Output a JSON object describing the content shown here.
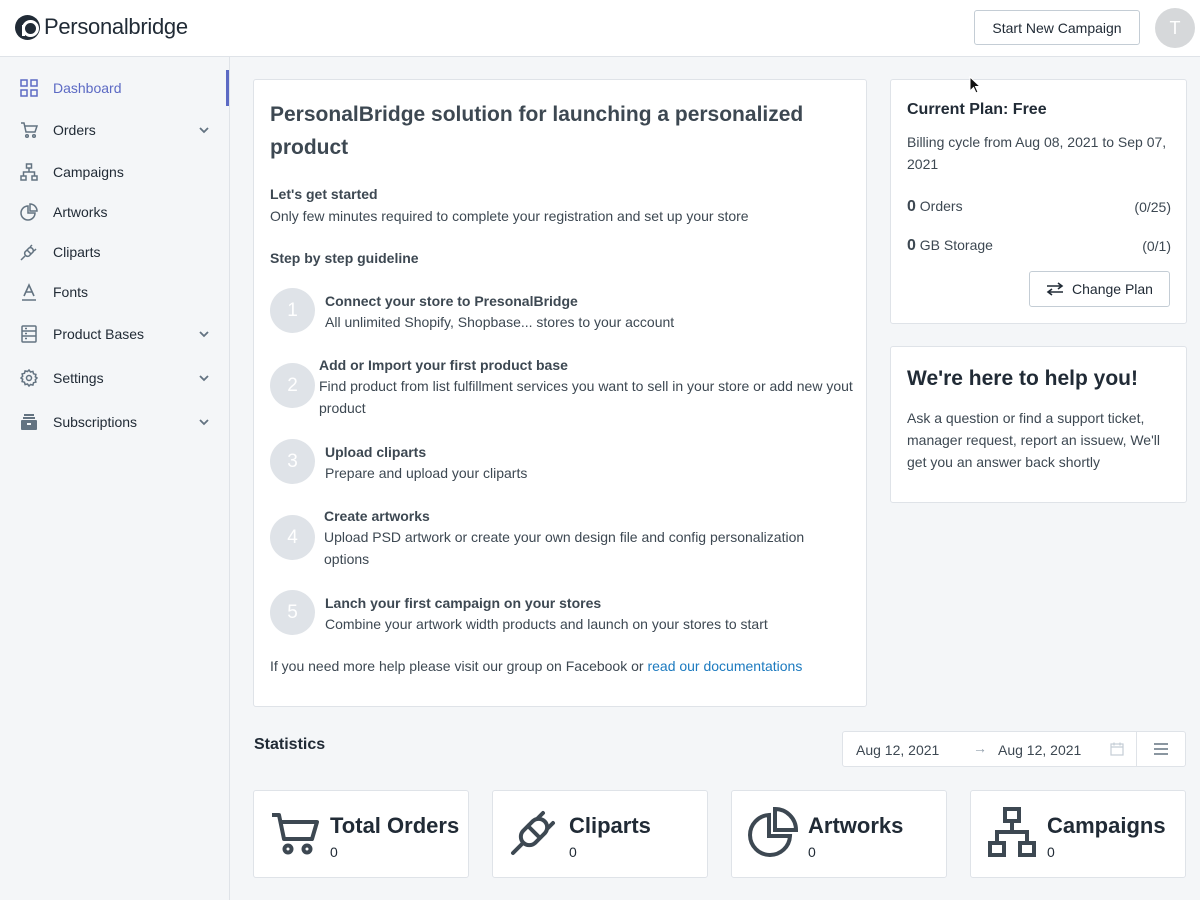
{
  "header": {
    "logo_text": "Personalbridge",
    "new_campaign_label": "Start New Campaign",
    "avatar_initial": "T"
  },
  "sidebar": {
    "items": [
      {
        "label": "Dashboard",
        "icon": "grid-icon",
        "active": true,
        "has_chevron": false
      },
      {
        "label": "Orders",
        "icon": "cart-icon",
        "active": false,
        "has_chevron": true
      },
      {
        "label": "Campaigns",
        "icon": "sitemap-icon",
        "active": false,
        "has_chevron": false
      },
      {
        "label": "Artworks",
        "icon": "pie-chart-icon",
        "active": false,
        "has_chevron": false
      },
      {
        "label": "Cliparts",
        "icon": "plug-icon",
        "active": false,
        "has_chevron": false
      },
      {
        "label": "Fonts",
        "icon": "font-icon",
        "active": false,
        "has_chevron": false
      },
      {
        "label": "Product Bases",
        "icon": "database-icon",
        "active": false,
        "has_chevron": true
      },
      {
        "label": "Settings",
        "icon": "gear-icon",
        "active": false,
        "has_chevron": true
      },
      {
        "label": "Subscriptions",
        "icon": "subscription-icon",
        "active": false,
        "has_chevron": true
      }
    ]
  },
  "guide": {
    "title": "PersonalBridge solution for launching a personalized product",
    "get_started": "Let's get started",
    "get_started_desc": "Only few minutes required to complete your registration and set up your store",
    "guideline_heading": "Step by step guideline",
    "steps": [
      {
        "num": "1",
        "title": "Connect your store to PresonalBridge",
        "desc": "All unlimited Shopify, Shopbase... stores to your account"
      },
      {
        "num": "2",
        "title": "Add or Import your first product base",
        "desc": "Find product from list fulfillment services you want to sell in your store or add new yout product"
      },
      {
        "num": "3",
        "title": "Upload cliparts",
        "desc": "Prepare and upload your cliparts"
      },
      {
        "num": "4",
        "title": "Create artworks",
        "desc": "Upload PSD artwork or create your own design file and config personalization options"
      },
      {
        "num": "5",
        "title": "Lanch your first campaign on your stores",
        "desc": "Combine your artwork width products and launch on your stores to start"
      }
    ],
    "help_text": "If you need more help please visit our group on Facebook or ",
    "help_link": "read our documentations"
  },
  "plan": {
    "title": "Current Plan: Free",
    "billing": "Billing cycle from Aug 08, 2021 to Sep 07, 2021",
    "orders_count": "0",
    "orders_label": "Orders",
    "orders_quota": "(0/25)",
    "storage_count": "0",
    "storage_label": "GB Storage",
    "storage_quota": "(0/1)",
    "change_plan_label": "Change Plan"
  },
  "help": {
    "title": "We're here to help you!",
    "text": "Ask a question or find a support ticket, manager request, report an issuew, We'll get you an answer back shortly"
  },
  "statistics": {
    "title": "Statistics",
    "date_from": "Aug 12, 2021",
    "date_arrow": "→",
    "date_to": "Aug 12, 2021",
    "cards": [
      {
        "name": "Total Orders",
        "value": "0",
        "icon": "cart-icon"
      },
      {
        "name": "Cliparts",
        "value": "0",
        "icon": "plug-icon"
      },
      {
        "name": "Artworks",
        "value": "0",
        "icon": "pie-chart-icon"
      },
      {
        "name": "Campaigns",
        "value": "0",
        "icon": "sitemap-icon"
      }
    ]
  },
  "colors": {
    "accent": "#5c6ac4",
    "link": "#1c7abf",
    "text": "#212b36"
  }
}
